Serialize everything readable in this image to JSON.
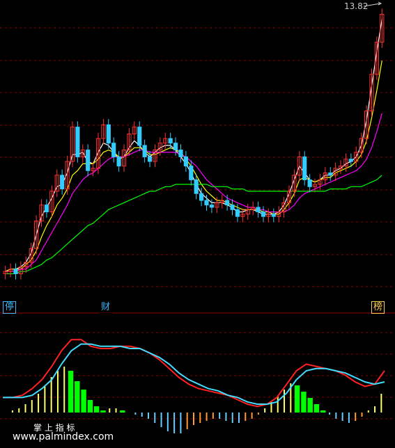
{
  "main_panel": {
    "peak_price_label": "13.82",
    "markers": [
      {
        "text": "停",
        "color": "#3fb6ff"
      },
      {
        "text": "财",
        "color": "#3fb6ff"
      },
      {
        "text": "榜",
        "color": "#ffcc55"
      }
    ]
  },
  "indicator_panel": {
    "title": "掌 上 指 标"
  },
  "watermark": "www.palmindex.com",
  "colors": {
    "background": "#000000",
    "grid": "#8b0000",
    "up_candle": "#ff3333",
    "down_candle": "#33ccff",
    "ma_short": "#ffffff",
    "ma_mid": "#ffff00",
    "ma_long": "#ff00ff",
    "ma_longest": "#00ff00",
    "indicator_line_a": "#ff2222",
    "indicator_line_b": "#44ddff",
    "hist_pos_strong": "#00ff00",
    "hist_pos_weak": "#ffff66",
    "hist_neg_blue": "#66ccff",
    "hist_neg_orange": "#ff9933"
  },
  "chart_data": [
    {
      "type": "line",
      "title": "",
      "candles_close": [
        2.6,
        2.7,
        2.5,
        2.8,
        3.0,
        3.6,
        4.8,
        5.5,
        5.2,
        6.1,
        6.8,
        6.2,
        7.4,
        8.9,
        7.6,
        7.9,
        7.0,
        7.1,
        8.4,
        9.0,
        8.2,
        7.6,
        7.2,
        7.9,
        8.6,
        8.9,
        8.1,
        7.6,
        7.4,
        7.9,
        8.2,
        8.4,
        8.2,
        7.9,
        7.6,
        7.2,
        6.6,
        6.0,
        5.7,
        5.5,
        5.4,
        5.6,
        5.7,
        5.5,
        5.3,
        5.0,
        5.1,
        5.3,
        5.4,
        5.2,
        5.0,
        5.1,
        5.0,
        5.2,
        5.6,
        6.1,
        6.8,
        7.6,
        6.6,
        6.3,
        6.4,
        6.6,
        6.9,
        6.8,
        7.1,
        7.2,
        7.5,
        7.4,
        7.8,
        8.4,
        9.6,
        11.2,
        12.6,
        13.82
      ],
      "series": [
        {
          "name": "",
          "values": [
            2.6,
            2.7,
            2.7,
            2.8,
            3.0,
            3.4,
            4.2,
            5.0,
            5.4,
            5.8,
            6.3,
            6.4,
            6.9,
            7.7,
            7.7,
            7.8,
            7.4,
            7.3,
            7.8,
            8.2,
            8.1,
            7.8,
            7.5,
            7.6,
            8.0,
            8.3,
            8.1,
            7.8,
            7.6,
            7.8,
            8.0,
            8.1,
            8.1,
            7.9,
            7.6,
            7.3,
            6.9,
            6.4,
            6.0,
            5.8,
            5.6,
            5.6,
            5.6,
            5.5,
            5.4,
            5.2,
            5.2,
            5.3,
            5.3,
            5.2,
            5.1,
            5.1,
            5.1,
            5.2,
            5.5,
            6.0,
            6.6,
            7.2,
            6.9,
            6.6,
            6.5,
            6.6,
            6.8,
            6.8,
            7.0,
            7.1,
            7.3,
            7.4,
            7.6,
            8.1,
            9.2,
            10.7,
            12.2,
            13.6
          ]
        },
        {
          "name": "",
          "values": [
            2.6,
            2.7,
            2.7,
            2.7,
            2.9,
            3.1,
            3.5,
            4.1,
            4.6,
            5.0,
            5.5,
            5.8,
            6.2,
            6.8,
            7.0,
            7.3,
            7.3,
            7.3,
            7.5,
            7.8,
            7.9,
            7.8,
            7.6,
            7.6,
            7.8,
            8.0,
            8.0,
            7.9,
            7.7,
            7.7,
            7.8,
            7.9,
            8.0,
            7.9,
            7.8,
            7.5,
            7.2,
            6.8,
            6.4,
            6.1,
            5.9,
            5.7,
            5.7,
            5.6,
            5.5,
            5.4,
            5.3,
            5.3,
            5.3,
            5.3,
            5.2,
            5.2,
            5.1,
            5.1,
            5.3,
            5.6,
            6.0,
            6.6,
            6.7,
            6.6,
            6.5,
            6.6,
            6.7,
            6.7,
            6.9,
            7.0,
            7.1,
            7.2,
            7.4,
            7.7,
            8.3,
            9.3,
            10.5,
            11.8
          ]
        },
        {
          "name": "",
          "values": [
            2.6,
            2.6,
            2.6,
            2.7,
            2.7,
            2.9,
            3.1,
            3.5,
            3.9,
            4.3,
            4.7,
            5.1,
            5.5,
            6.0,
            6.3,
            6.6,
            6.8,
            6.9,
            7.1,
            7.3,
            7.5,
            7.6,
            7.6,
            7.6,
            7.7,
            7.8,
            7.9,
            7.9,
            7.8,
            7.8,
            7.8,
            7.8,
            7.8,
            7.8,
            7.7,
            7.6,
            7.4,
            7.2,
            6.9,
            6.6,
            6.4,
            6.2,
            6.0,
            5.8,
            5.7,
            5.6,
            5.5,
            5.4,
            5.4,
            5.3,
            5.3,
            5.2,
            5.2,
            5.2,
            5.2,
            5.3,
            5.5,
            5.8,
            6.0,
            6.1,
            6.2,
            6.3,
            6.4,
            6.5,
            6.6,
            6.7,
            6.8,
            6.9,
            7.0,
            7.2,
            7.5,
            8.0,
            8.7,
            9.5
          ]
        },
        {
          "name": "",
          "values": [
            2.5,
            2.5,
            2.5,
            2.6,
            2.6,
            2.7,
            2.8,
            2.9,
            3.1,
            3.2,
            3.4,
            3.6,
            3.8,
            4.0,
            4.2,
            4.4,
            4.6,
            4.7,
            4.9,
            5.1,
            5.3,
            5.4,
            5.5,
            5.6,
            5.7,
            5.8,
            5.9,
            6.0,
            6.1,
            6.1,
            6.2,
            6.3,
            6.3,
            6.4,
            6.4,
            6.4,
            6.4,
            6.4,
            6.4,
            6.4,
            6.3,
            6.3,
            6.3,
            6.3,
            6.2,
            6.2,
            6.2,
            6.1,
            6.1,
            6.1,
            6.1,
            6.1,
            6.1,
            6.1,
            6.1,
            6.1,
            6.1,
            6.1,
            6.1,
            6.1,
            6.1,
            6.1,
            6.1,
            6.2,
            6.2,
            6.2,
            6.2,
            6.3,
            6.3,
            6.3,
            6.4,
            6.5,
            6.6,
            6.8
          ]
        }
      ]
    },
    {
      "type": "bar",
      "title": "",
      "values": [
        0.0,
        0.1,
        0.2,
        0.4,
        0.6,
        0.9,
        1.3,
        1.7,
        2.0,
        2.2,
        2.0,
        1.5,
        1.1,
        0.6,
        0.3,
        0.1,
        0.2,
        0.2,
        0.1,
        0.0,
        -0.1,
        -0.2,
        -0.3,
        -0.5,
        -0.7,
        -0.9,
        -1.0,
        -1.0,
        -0.8,
        -0.6,
        -0.5,
        -0.4,
        -0.3,
        -0.3,
        -0.4,
        -0.5,
        -0.5,
        -0.4,
        -0.3,
        -0.1,
        0.2,
        0.5,
        0.8,
        1.1,
        1.4,
        1.3,
        1.0,
        0.7,
        0.4,
        0.1,
        -0.1,
        -0.3,
        -0.4,
        -0.5,
        -0.4,
        -0.2,
        0.1,
        0.3,
        0.9
      ],
      "series": [
        {
          "name": "",
          "values": [
            -0.2,
            -0.2,
            -0.1,
            0.2,
            0.6,
            1.2,
            1.9,
            2.4,
            2.4,
            2.1,
            2.0,
            2.0,
            2.1,
            2.1,
            2.0,
            1.8,
            1.5,
            1.1,
            0.7,
            0.4,
            0.2,
            0.1,
            0.0,
            -0.1,
            -0.3,
            -0.5,
            -0.6,
            -0.5,
            -0.2,
            0.4,
            1.0,
            1.3,
            1.2,
            1.1,
            1.0,
            0.8,
            0.5,
            0.3,
            0.4,
            1.0
          ]
        },
        {
          "name": "",
          "values": [
            -0.2,
            -0.2,
            -0.2,
            -0.1,
            0.2,
            0.6,
            1.3,
            1.9,
            2.2,
            2.2,
            2.1,
            2.1,
            2.1,
            2.0,
            2.0,
            1.8,
            1.6,
            1.3,
            0.9,
            0.6,
            0.4,
            0.2,
            0.1,
            -0.1,
            -0.2,
            -0.4,
            -0.5,
            -0.5,
            -0.4,
            0.0,
            0.6,
            1.0,
            1.1,
            1.1,
            1.0,
            0.9,
            0.7,
            0.5,
            0.4,
            0.5
          ]
        }
      ]
    }
  ]
}
